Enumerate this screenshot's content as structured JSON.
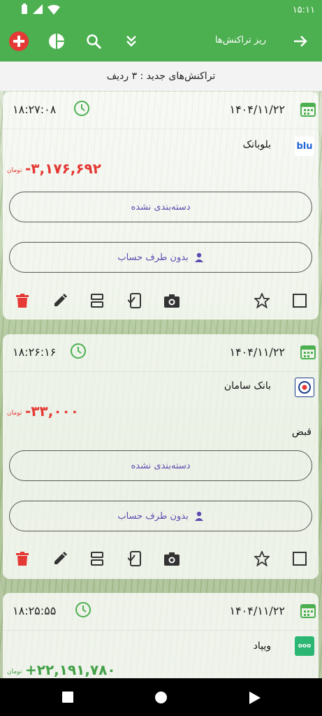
{
  "status": {
    "time": "۱۵:۱۱"
  },
  "appbar": {
    "title": "ریز تراکنش‌ها"
  },
  "header": {
    "count_text": "تراکنش‌های جدید : ۳ ردیف"
  },
  "cards": [
    {
      "date": "۱۴۰۴/۱۱/۲۲",
      "time": "۱۸:۲۷:۰۸",
      "bank": "بلوبانک",
      "amount": "-۳,۱۷۶,۶۹۲",
      "currency": "تومان",
      "category": "دسته‌بندی نشده",
      "party": "بدون طرف حساب",
      "note": ""
    },
    {
      "date": "۱۴۰۴/۱۱/۲۲",
      "time": "۱۸:۲۶:۱۶",
      "bank": "بانک سامان",
      "amount": "-۳۳,۰۰۰",
      "currency": "تومان",
      "category": "دسته‌بندی نشده",
      "party": "بدون طرف حساب",
      "note": "قبض"
    },
    {
      "date": "۱۴۰۴/۱۱/۲۲",
      "time": "۱۸:۲۵:۵۵",
      "bank": "ویپاد",
      "amount": "+۲۲,۱۹۱,۷۸۰",
      "currency": "تومان"
    }
  ],
  "logos": {
    "blu": "blu",
    "wepod": "ooo"
  },
  "colors": {
    "primary": "#4caf50",
    "negative": "#e53935",
    "positive": "#43a047",
    "accent": "#5e4bb0",
    "delete": "#e53935"
  }
}
